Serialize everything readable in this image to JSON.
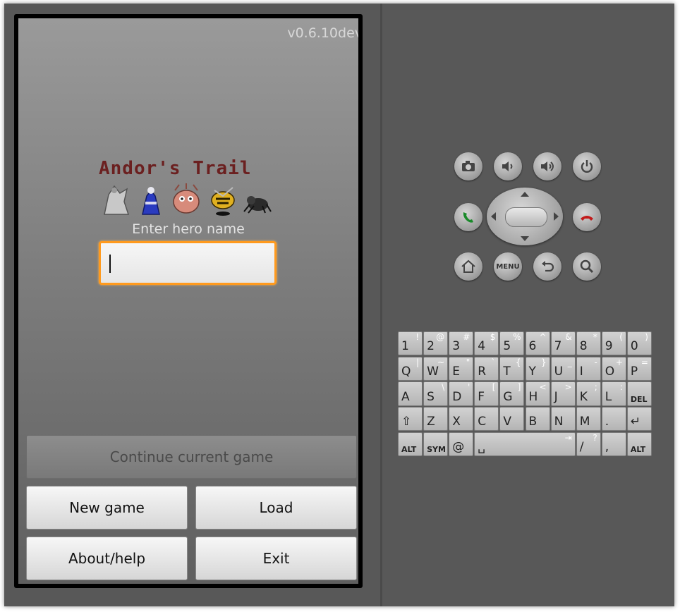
{
  "screen": {
    "version": "v0.6.10dev",
    "logo_title": "Andor's Trail",
    "hero_label": "Enter hero name",
    "hero_input_value": "",
    "buttons": {
      "continue": "Continue current game",
      "new_game": "New game",
      "load": "Load",
      "about": "About/help",
      "exit": "Exit"
    },
    "continue_enabled": false
  },
  "hardware": {
    "menu_label": "MENU",
    "icons": [
      "camera-icon",
      "volume-down-icon",
      "volume-up-icon",
      "power-icon",
      "call-icon",
      "end-call-icon",
      "home-icon",
      "back-icon",
      "search-icon"
    ]
  },
  "keyboard": {
    "rows": [
      [
        {
          "k": "1",
          "a": "!"
        },
        {
          "k": "2",
          "a": "@"
        },
        {
          "k": "3",
          "a": "#"
        },
        {
          "k": "4",
          "a": "$"
        },
        {
          "k": "5",
          "a": "%"
        },
        {
          "k": "6",
          "a": "^"
        },
        {
          "k": "7",
          "a": "&"
        },
        {
          "k": "8",
          "a": "*"
        },
        {
          "k": "9",
          "a": "("
        },
        {
          "k": "0",
          "a": ")"
        }
      ],
      [
        {
          "k": "Q",
          "a": "|"
        },
        {
          "k": "W",
          "a": "~"
        },
        {
          "k": "E",
          "a": "\""
        },
        {
          "k": "R",
          "a": "`"
        },
        {
          "k": "T",
          "a": "{"
        },
        {
          "k": "Y",
          "a": "}"
        },
        {
          "k": "U",
          "a": "_"
        },
        {
          "k": "I",
          "a": "-"
        },
        {
          "k": "O",
          "a": "+"
        },
        {
          "k": "P",
          "a": "="
        }
      ],
      [
        {
          "k": "A",
          "a": ""
        },
        {
          "k": "S",
          "a": "\\"
        },
        {
          "k": "D",
          "a": "'"
        },
        {
          "k": "F",
          "a": "["
        },
        {
          "k": "G",
          "a": "]"
        },
        {
          "k": "H",
          "a": "<"
        },
        {
          "k": "J",
          "a": ">"
        },
        {
          "k": "K",
          "a": ";"
        },
        {
          "k": "L",
          "a": ":"
        },
        {
          "k": "DEL",
          "a": ""
        }
      ],
      [
        {
          "k": "⇧",
          "a": ""
        },
        {
          "k": "Z",
          "a": ""
        },
        {
          "k": "X",
          "a": ""
        },
        {
          "k": "C",
          "a": ""
        },
        {
          "k": "V",
          "a": ""
        },
        {
          "k": "B",
          "a": ""
        },
        {
          "k": "N",
          "a": ""
        },
        {
          "k": "M",
          "a": ""
        },
        {
          "k": ".",
          "a": ""
        },
        {
          "k": "↵",
          "a": ""
        }
      ],
      [
        {
          "k": "ALT",
          "a": ""
        },
        {
          "k": "SYM",
          "a": ""
        },
        {
          "k": "@",
          "a": ""
        },
        {
          "k": "␣",
          "a": "⇥"
        },
        {
          "k": "/",
          "a": "?"
        },
        {
          "k": ",",
          "a": ""
        },
        {
          "k": "ALT",
          "a": ""
        }
      ]
    ]
  }
}
